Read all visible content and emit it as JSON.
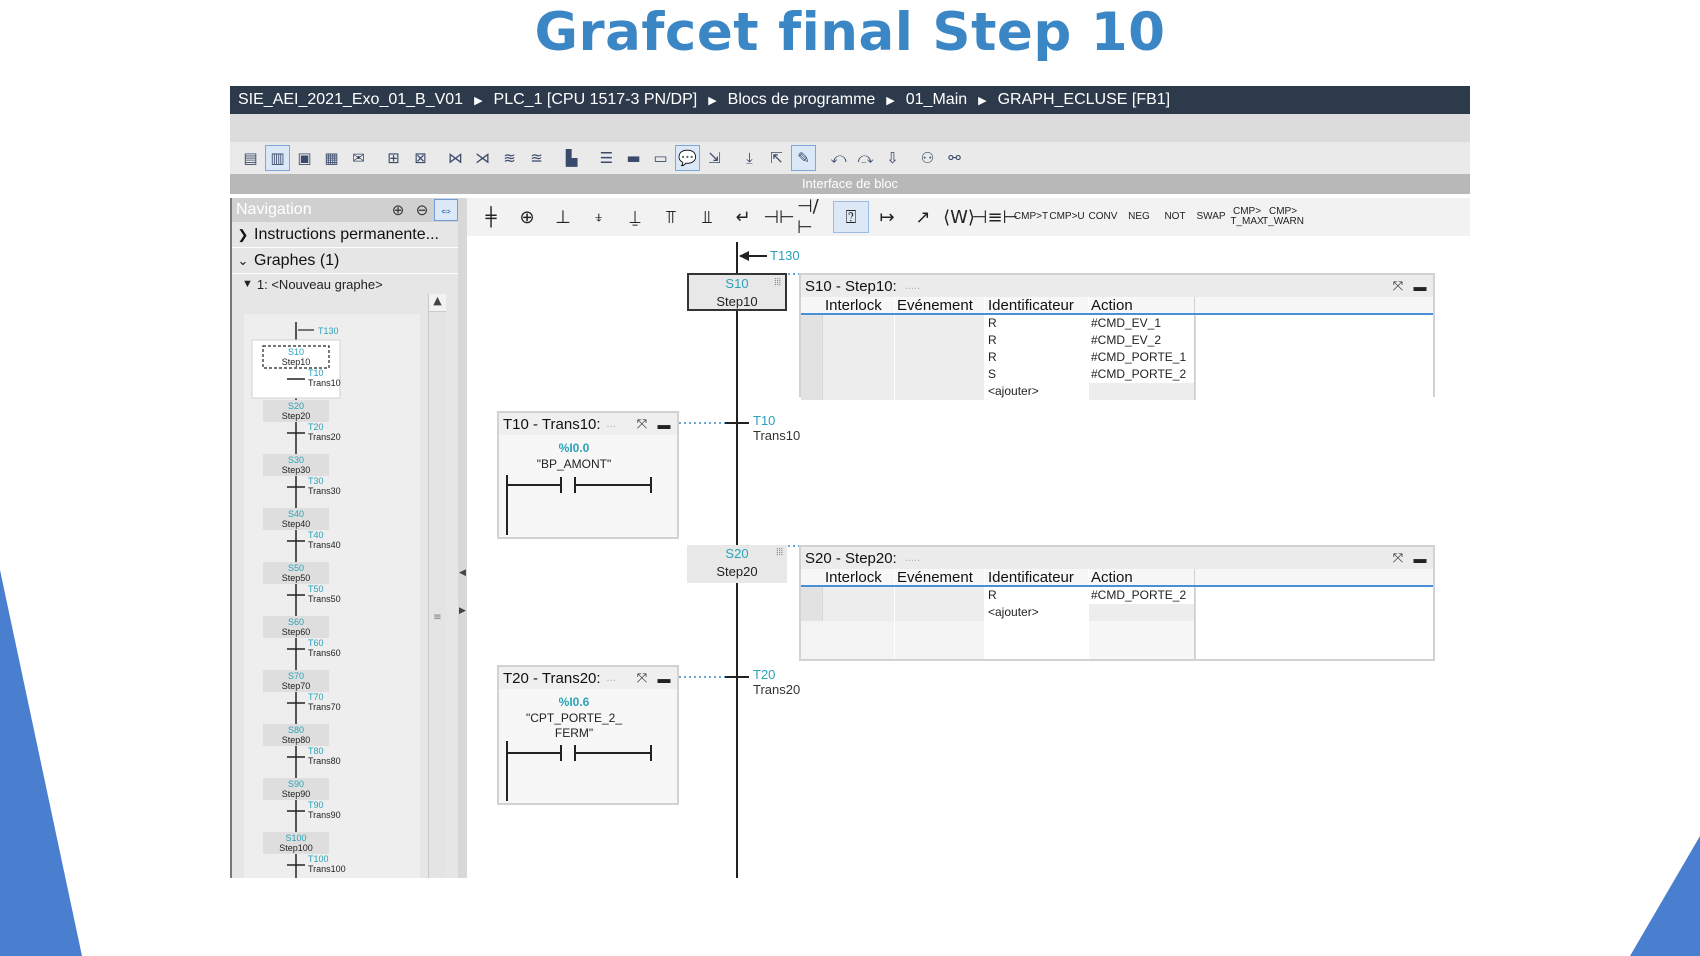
{
  "slide": {
    "title": "Grafcet final Step 10",
    "accent_color": "#3b87c6"
  },
  "breadcrumb": [
    "SIE_AEI_2021_Exo_01_B_V01",
    "PLC_1 [CPU 1517-3 PN/DP]",
    "Blocs de programme",
    "01_Main",
    "GRAPH_ECLUSE [FB1]"
  ],
  "interface_label": "Interface de bloc",
  "navigation": {
    "title": "Navigation",
    "sections": [
      {
        "label": "Instructions permanente...",
        "expanded": false
      },
      {
        "label": "Graphes (1)",
        "expanded": true
      }
    ],
    "graph_label": "1: <Nouveau graphe>",
    "top_transition": "T130",
    "mini_steps": [
      {
        "step_no": "S10",
        "step_name": "Step10",
        "trans_no": "T10",
        "trans_name": "Trans10"
      },
      {
        "step_no": "S20",
        "step_name": "Step20",
        "trans_no": "T20",
        "trans_name": "Trans20"
      },
      {
        "step_no": "S30",
        "step_name": "Step30",
        "trans_no": "T30",
        "trans_name": "Trans30"
      },
      {
        "step_no": "S40",
        "step_name": "Step40",
        "trans_no": "T40",
        "trans_name": "Trans40"
      },
      {
        "step_no": "S50",
        "step_name": "Step50",
        "trans_no": "T50",
        "trans_name": "Trans50"
      },
      {
        "step_no": "S60",
        "step_name": "Step60",
        "trans_no": "T60",
        "trans_name": "Trans60"
      },
      {
        "step_no": "S70",
        "step_name": "Step70",
        "trans_no": "T70",
        "trans_name": "Trans70"
      },
      {
        "step_no": "S80",
        "step_name": "Step80",
        "trans_no": "T80",
        "trans_name": "Trans80"
      },
      {
        "step_no": "S90",
        "step_name": "Step90",
        "trans_no": "T90",
        "trans_name": "Trans90"
      },
      {
        "step_no": "S100",
        "step_name": "Step100",
        "trans_no": "T100",
        "trans_name": "Trans100"
      }
    ]
  },
  "instruction_toolbar": [
    "CMP>T",
    "CMP>U",
    "CONV",
    "NEG",
    "NOT",
    "SWAP",
    "CMP> T_MAX",
    "CMP> T_WARN"
  ],
  "graph": {
    "top_transition": "T130",
    "steps": [
      {
        "number": "S10",
        "name": "Step10",
        "panel_title": "S10 - Step10:",
        "columns": [
          "Interlock",
          "Evénement",
          "Identificateur",
          "Action"
        ],
        "actions": [
          {
            "qualifier": "R",
            "action": "#CMD_EV_1"
          },
          {
            "qualifier": "R",
            "action": "#CMD_EV_2"
          },
          {
            "qualifier": "R",
            "action": "#CMD_PORTE_1"
          },
          {
            "qualifier": "S",
            "action": "#CMD_PORTE_2"
          }
        ],
        "add_label": "<ajouter>"
      },
      {
        "number": "S20",
        "name": "Step20",
        "panel_title": "S20 - Step20:",
        "columns": [
          "Interlock",
          "Evénement",
          "Identificateur",
          "Action"
        ],
        "actions": [
          {
            "qualifier": "R",
            "action": "#CMD_PORTE_2"
          }
        ],
        "add_label": "<ajouter>"
      }
    ],
    "transitions": [
      {
        "number": "T10",
        "name": "Trans10",
        "panel_title": "T10 - Trans10:",
        "address": "%I0.0",
        "symbol_lines": [
          "\"BP_AMONT\""
        ]
      },
      {
        "number": "T20",
        "name": "Trans20",
        "panel_title": "T20 - Trans20:",
        "address": "%I0.6",
        "symbol_lines": [
          "\"CPT_PORTE_2_",
          "FERM\""
        ]
      }
    ]
  },
  "colors": {
    "step_number": "#29a3b8",
    "breadcrumb_bg": "#2d3a4c",
    "table_header_rule": "#4a8ed6"
  }
}
